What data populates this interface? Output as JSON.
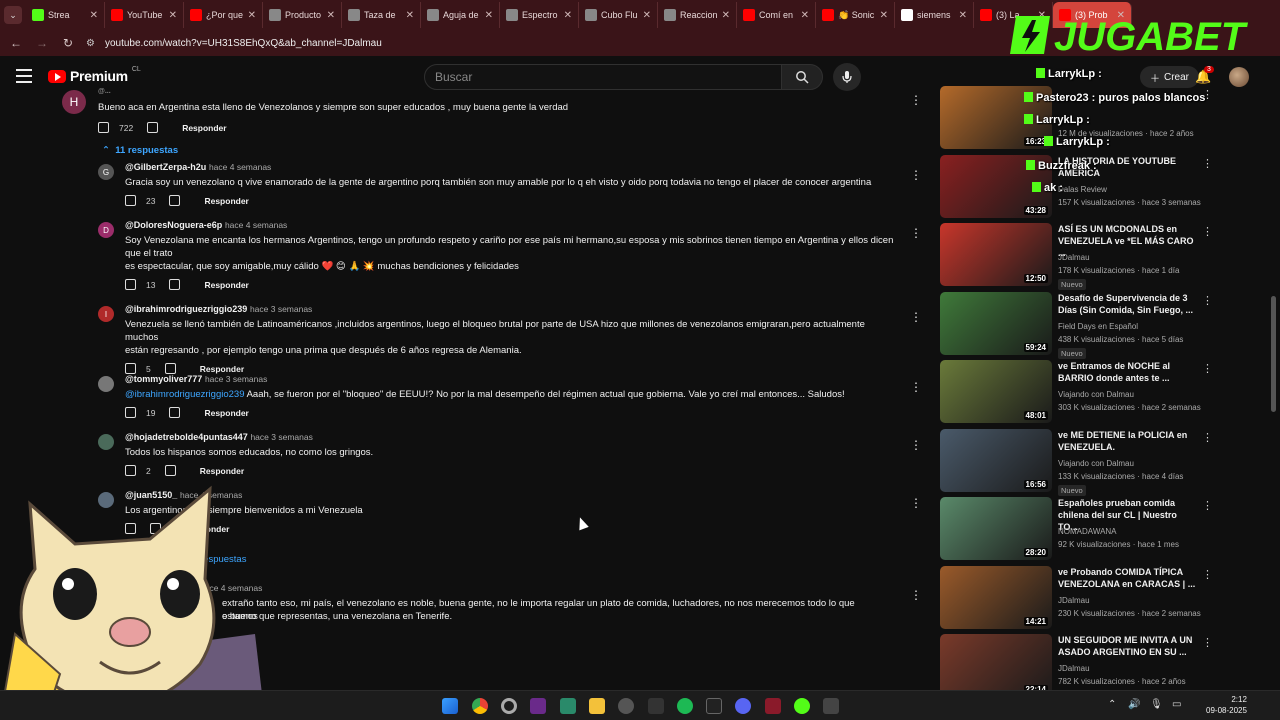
{
  "browser": {
    "tabs": [
      {
        "label": "Strea",
        "color": "#53fc18"
      },
      {
        "label": "YouTube",
        "color": "#ff0000"
      },
      {
        "label": "¿Por que",
        "color": "#ff0000"
      },
      {
        "label": "Producto",
        "color": "#888888"
      },
      {
        "label": "Taza de",
        "color": "#888888"
      },
      {
        "label": "Aguja de",
        "color": "#888888"
      },
      {
        "label": "Espectro",
        "color": "#888888"
      },
      {
        "label": "Cubo Flu",
        "color": "#888888"
      },
      {
        "label": "Reaccion",
        "color": "#888888"
      },
      {
        "label": "Comí en",
        "color": "#ff0000"
      },
      {
        "label": "👏 Sonic",
        "color": "#ff0000"
      },
      {
        "label": "siemens",
        "color": "#ffffff"
      },
      {
        "label": "(3) La",
        "color": "#ff0000"
      },
      {
        "label": "(3) Prob",
        "color": "#ff0000"
      }
    ],
    "url": "youtube.com/watch?v=UH31S8EhQxQ&ab_channel=JDalmau"
  },
  "header": {
    "brand": "Premium",
    "region": "CL",
    "search_placeholder": "Buscar",
    "create_label": "Crear",
    "notifications": "3"
  },
  "comments": {
    "top": {
      "avatar": "H",
      "author": "@...",
      "text": "Bueno aca en Argentina esta lleno de Venezolanos y siempre son super educados , muy buena gente la verdad",
      "likes": "722",
      "reply": "Responder"
    },
    "replies_label": "11 respuestas",
    "list": [
      {
        "avatar": "G",
        "author": "@GilbertZerpa-h2u",
        "ago": "hace 4 semanas",
        "text": "Gracia soy un venezolano q vive enamorado de la gente de argentino porq también son muy amable por lo q eh visto y oido porq todavia no tengo el placer de conocer argentina",
        "likes": "23",
        "reply": "Responder"
      },
      {
        "avatar": "D",
        "author": "@DoloresNoguera-e6p",
        "ago": "hace 4 semanas",
        "text": "Soy Venezolana me encanta los hermanos Argentinos, tengo un profundo respeto y cariño por ese país mi hermano,su esposa y mis sobrinos tienen tiempo en Argentina y ellos dicen que el trato",
        "text2": "es espectacular, que soy amigable,muy cálido ❤️ 😊 🙏 💥 muchas bendiciones y felicidades",
        "likes": "13",
        "reply": "Responder"
      },
      {
        "avatar": "I",
        "author": "@ibrahimrodriguezriggio239",
        "ago": "hace 3 semanas",
        "text": "Venezuela se llenó también de Latinoaméricanos ,incluidos argentinos, luego el bloqueo brutal por parte de USA hizo que millones de venezolanos emigraran,pero actualmente muchos",
        "text2": "están regresando , por ejemplo tengo una prima que después de 6 años regresa de Alemania.",
        "likes": "5",
        "reply": "Responder"
      },
      {
        "avatar": "",
        "author": "@tommyoliver777",
        "ago": "hace 3 semanas",
        "mention": "@ibrahimrodriguezriggio239",
        "text": " Aaah, se fueron por el \"bloqueo\" de EEUU!? No por la mal desempeño del régimen actual que gobierna. Vale yo creí mal entonces... Saludos!",
        "likes": "19",
        "reply": "Responder"
      },
      {
        "avatar": "",
        "author": "@hojadetrebolde4puntas447",
        "ago": "hace 3 semanas",
        "text": "Todos los hispanos somos educados, no como los gringos.",
        "likes": "2",
        "reply": "Responder"
      },
      {
        "avatar": "",
        "author": "@juan5150_",
        "ago": "hace 4 semanas",
        "text": "Los argentinos son siempre bienvenidos a mi Venezuela",
        "reply": "Responder"
      }
    ],
    "partial_link": "respuestas",
    "partial_ago": "hace 4 semanas",
    "partial_text": "extraño tanto eso, mi país, el venezolano es noble, buena gente, no le importa regalar un plato de comida, luchadores, no nos merecemos todo lo que estamos",
    "partial_text2": "o bueno que representas, una venezolana en Tenerife."
  },
  "sidebar": {
    "videos": [
      {
        "title": "",
        "channel": "",
        "meta": "12 M de visualizaciones · hace 2 años",
        "duration": "16:23",
        "thumb_color": "#b46a2a"
      },
      {
        "title": "LA HISTORIA DE YOUTUBE AMÉRICA",
        "channel": "Dalas Review",
        "meta": "157 K visualizaciones · hace 3 semanas",
        "duration": "43:28",
        "thumb_color": "#8a2020"
      },
      {
        "title": "ASÍ ES UN MCDONALDS en VENEZUELA ve *EL MÁS CARO ...",
        "channel": "JDalmau",
        "meta": "178 K visualizaciones · hace 1 día",
        "duration": "12:50",
        "badge": "Nuevo",
        "thumb_color": "#c8362b"
      },
      {
        "title": "Desafío de Supervivencia de 3 Días (Sin Comida, Sin Fuego, ...",
        "channel": "Field Days en Español",
        "meta": "438 K visualizaciones · hace 5 días",
        "duration": "59:24",
        "badge": "Nuevo",
        "thumb_color": "#3f7a3a"
      },
      {
        "title": "ve Entramos de NOCHE al BARRIO donde antes te ...",
        "channel": "Viajando con Dalmau",
        "meta": "303 K visualizaciones · hace 2 semanas",
        "duration": "48:01",
        "thumb_color": "#6a7a3a"
      },
      {
        "title": "ve ME DETIENE la POLICIA en VENEZUELA.",
        "channel": "Viajando con Dalmau",
        "meta": "133 K visualizaciones · hace 4 días",
        "duration": "16:56",
        "badge": "Nuevo",
        "thumb_color": "#4a5a6a"
      },
      {
        "title": "Españoles prueban comida chilena del sur CL | Nuestro TO...",
        "channel": "NOMADAWANA",
        "meta": "92 K visualizaciones · hace 1 mes",
        "duration": "28:20",
        "thumb_color": "#5a8a6a"
      },
      {
        "title": "ve Probando COMIDA TÍPICA VENEZOLANA en CARACAS | ...",
        "channel": "JDalmau",
        "meta": "230 K visualizaciones · hace 2 semanas",
        "duration": "14:21",
        "thumb_color": "#9a5a2a"
      },
      {
        "title": "UN SEGUIDOR ME INVITA A UN ASADO ARGENTINO EN SU ...",
        "channel": "JDalmau",
        "meta": "782 K visualizaciones · hace 2 años",
        "duration": "22:14",
        "thumb_color": "#7a3a2a"
      }
    ]
  },
  "overlay": {
    "brand": "JUGABET",
    "chat": [
      {
        "user": "LarrykLp :",
        "msg": ""
      },
      {
        "user": "Pastero23 :",
        "msg": "puros palos blancos"
      },
      {
        "user": "LarrykLp :",
        "msg": ""
      },
      {
        "user": "LarrykLp :",
        "msg": ""
      },
      {
        "user": "Buzzfreak :",
        "msg": ""
      },
      {
        "user": "ak :",
        "msg": ""
      }
    ]
  },
  "taskbar": {
    "time": "2:12",
    "date": "09-08-2025"
  }
}
